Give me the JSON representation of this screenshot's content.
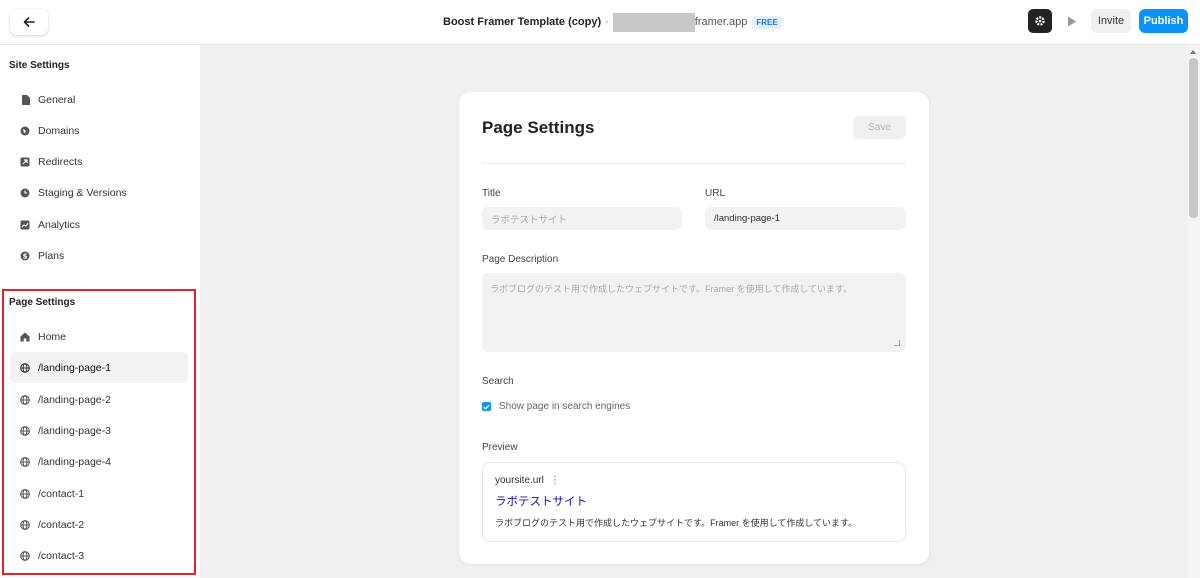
{
  "topbar": {
    "project_name": "Boost Framer Template (copy)",
    "separator": "·",
    "domain_suffix": "framer.app",
    "plan_badge": "FREE",
    "invite_label": "Invite",
    "publish_label": "Publish"
  },
  "sidebar": {
    "site_settings_title": "Site Settings",
    "site_items": [
      {
        "label": "General",
        "icon": "document-icon"
      },
      {
        "label": "Domains",
        "icon": "globe-icon"
      },
      {
        "label": "Redirects",
        "icon": "redirect-icon"
      },
      {
        "label": "Staging & Versions",
        "icon": "clock-icon"
      },
      {
        "label": "Analytics",
        "icon": "chart-icon"
      },
      {
        "label": "Plans",
        "icon": "dollar-icon"
      }
    ],
    "page_settings_title": "Page Settings",
    "page_items": [
      {
        "label": "Home",
        "icon": "home-icon"
      },
      {
        "label": "/landing-page-1",
        "icon": "globe-icon",
        "active": true
      },
      {
        "label": "/landing-page-2",
        "icon": "globe-icon"
      },
      {
        "label": "/landing-page-3",
        "icon": "globe-icon"
      },
      {
        "label": "/landing-page-4",
        "icon": "globe-icon"
      },
      {
        "label": "/contact-1",
        "icon": "globe-icon"
      },
      {
        "label": "/contact-2",
        "icon": "globe-icon"
      },
      {
        "label": "/contact-3",
        "icon": "globe-icon"
      }
    ]
  },
  "page_settings": {
    "title": "Page Settings",
    "save_label": "Save",
    "title_label": "Title",
    "title_placeholder": "ラボテストサイト",
    "url_label": "URL",
    "url_value": "/landing-page-1",
    "description_label": "Page Description",
    "description_placeholder": "ラボブログのテスト用で作成したウェブサイトです。Framer を使用して作成しています。",
    "search_label": "Search",
    "search_checkbox_label": "Show page in search engines",
    "search_checked": true,
    "preview_label": "Preview",
    "preview": {
      "url": "yoursite.url",
      "dots": "⋮",
      "title": "ラボテストサイト",
      "description": "ラボブログのテスト用で作成したウェブサイトです。Framer を使用して作成しています。"
    }
  }
}
